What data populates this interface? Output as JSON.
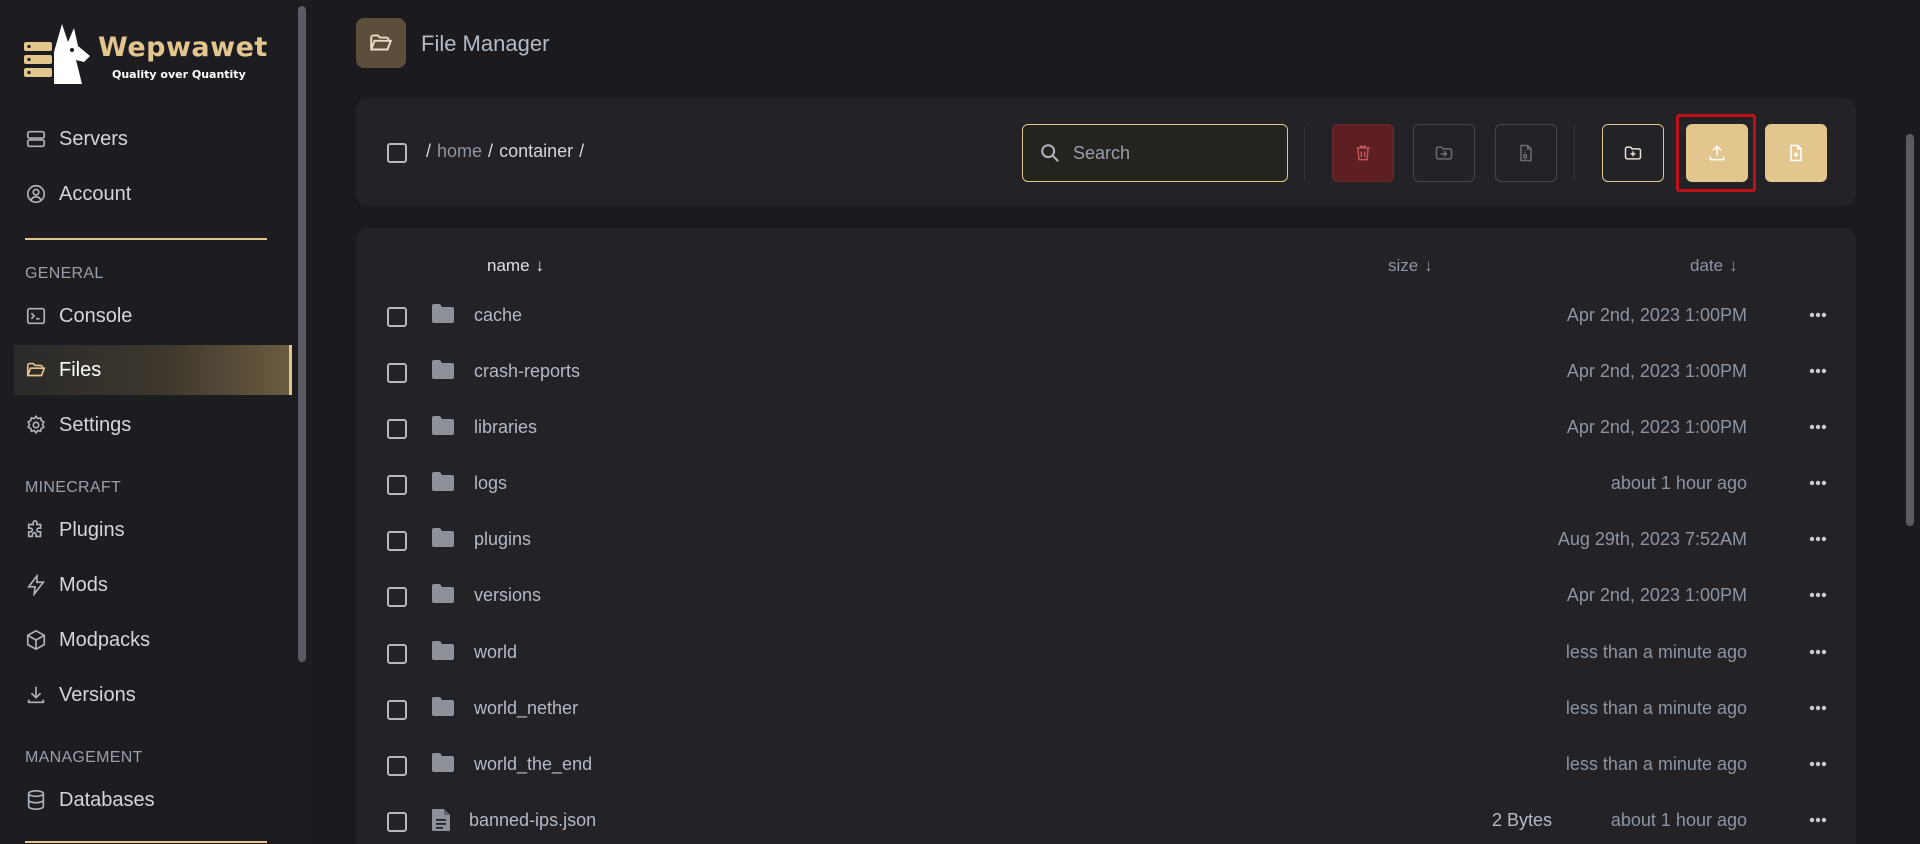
{
  "brand": {
    "name": "Wepwawet",
    "tagline": "Quality over Quantity"
  },
  "sidebar": {
    "top_items": [
      {
        "label": "Servers",
        "icon": "server-icon"
      },
      {
        "label": "Account",
        "icon": "user-circle-icon"
      }
    ],
    "sections": [
      {
        "title": "GENERAL",
        "items": [
          {
            "label": "Console",
            "icon": "terminal-icon"
          },
          {
            "label": "Files",
            "icon": "folder-open-icon",
            "active": true
          },
          {
            "label": "Settings",
            "icon": "gear-icon"
          }
        ]
      },
      {
        "title": "MINECRAFT",
        "items": [
          {
            "label": "Plugins",
            "icon": "puzzle-icon"
          },
          {
            "label": "Mods",
            "icon": "bolt-icon"
          },
          {
            "label": "Modpacks",
            "icon": "cube-icon"
          },
          {
            "label": "Versions",
            "icon": "download-icon"
          }
        ]
      },
      {
        "title": "MANAGEMENT",
        "items": [
          {
            "label": "Databases",
            "icon": "database-icon"
          }
        ]
      }
    ]
  },
  "page": {
    "title": "File Manager"
  },
  "toolbar": {
    "breadcrumb": {
      "root": "/",
      "home": "home",
      "sep1": "/",
      "container": "container",
      "sep2": "/"
    },
    "search_placeholder": "Search",
    "buttons": [
      "delete-button",
      "move-button",
      "archive-button",
      "new-folder-button",
      "upload-button",
      "new-file-button"
    ]
  },
  "columns": {
    "name": "name",
    "size": "size",
    "date": "date",
    "sort_arrow": "↓"
  },
  "files": [
    {
      "name": "cache",
      "type": "folder",
      "size": "",
      "date": "Apr 2nd, 2023 1:00PM"
    },
    {
      "name": "crash-reports",
      "type": "folder",
      "size": "",
      "date": "Apr 2nd, 2023 1:00PM"
    },
    {
      "name": "libraries",
      "type": "folder",
      "size": "",
      "date": "Apr 2nd, 2023 1:00PM"
    },
    {
      "name": "logs",
      "type": "folder",
      "size": "",
      "date": "about 1 hour ago"
    },
    {
      "name": "plugins",
      "type": "folder",
      "size": "",
      "date": "Aug 29th, 2023 7:52AM"
    },
    {
      "name": "versions",
      "type": "folder",
      "size": "",
      "date": "Apr 2nd, 2023 1:00PM"
    },
    {
      "name": "world",
      "type": "folder",
      "size": "",
      "date": "less than a minute ago"
    },
    {
      "name": "world_nether",
      "type": "folder",
      "size": "",
      "date": "less than a minute ago"
    },
    {
      "name": "world_the_end",
      "type": "folder",
      "size": "",
      "date": "less than a minute ago"
    },
    {
      "name": "banned-ips.json",
      "type": "file",
      "size": "2 Bytes",
      "date": "about 1 hour ago"
    }
  ],
  "colors": {
    "accent": "#e3c68e",
    "danger": "#5d1f22",
    "highlight": "#c0111a"
  }
}
